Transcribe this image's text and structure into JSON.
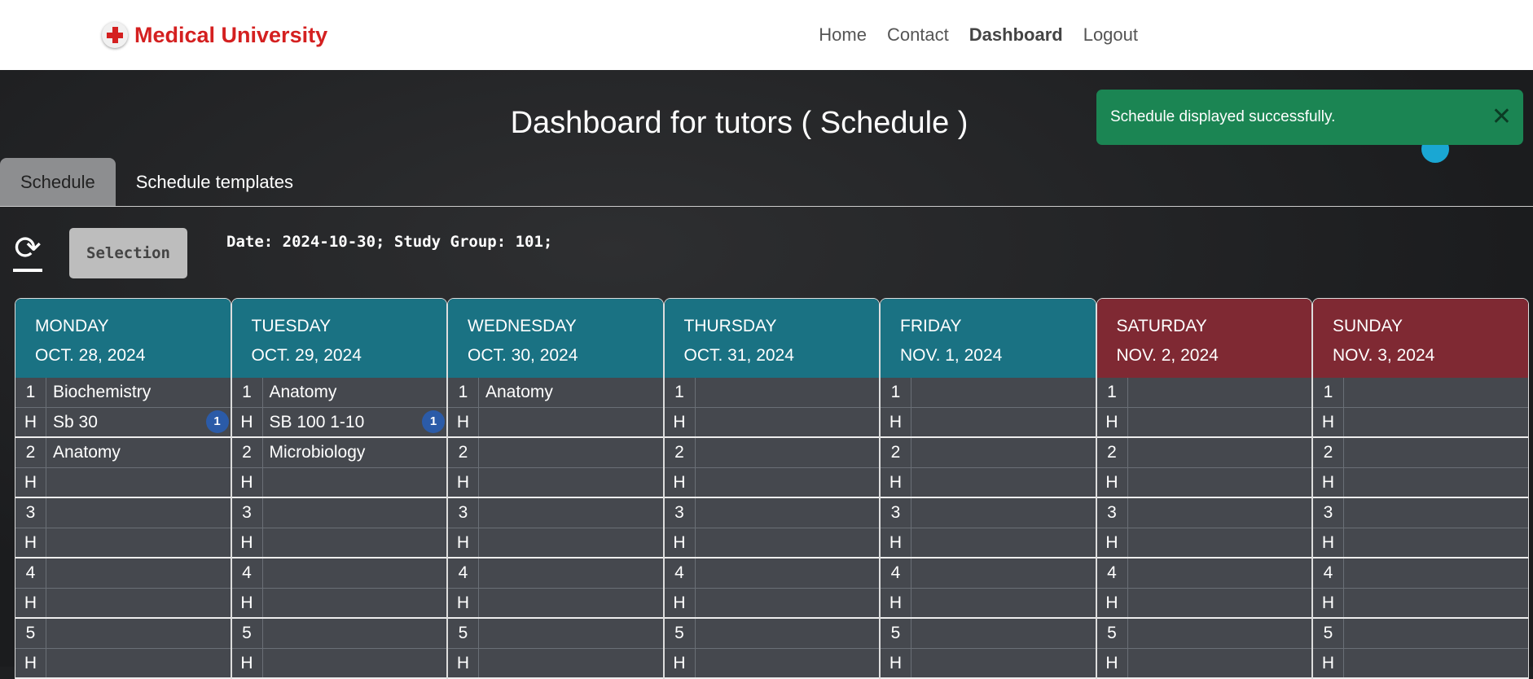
{
  "brand": {
    "name": "Medical University"
  },
  "nav": {
    "items": [
      "Home",
      "Contact",
      "Dashboard",
      "Logout"
    ],
    "active": "Dashboard"
  },
  "page": {
    "title": "Dashboard for tutors ( Schedule )"
  },
  "tabs": [
    {
      "label": "Schedule",
      "active": true
    },
    {
      "label": "Schedule templates",
      "active": false
    }
  ],
  "toolbar": {
    "refresh_icon": "refresh-icon",
    "selection_label": "Selection",
    "info": "Date: 2024-10-30; Study Group: 101;"
  },
  "toast": {
    "message": "Schedule displayed successfully.",
    "close_icon": "close-icon",
    "color": "#1b8553"
  },
  "colors": {
    "weekday_header": "#1a7283",
    "weekend_header": "#7f2933",
    "badge": "#2b5ba8"
  },
  "schedule": {
    "days": [
      {
        "name": "MONDAY",
        "date": "OCT. 28, 2024",
        "weekend": false,
        "rows": [
          [
            "1",
            "Biochemistry",
            ""
          ],
          [
            "H",
            "Sb 30",
            "1"
          ],
          [
            "2",
            "Anatomy",
            ""
          ],
          [
            "H",
            "",
            ""
          ],
          [
            "3",
            "",
            ""
          ],
          [
            "H",
            "",
            ""
          ],
          [
            "4",
            "",
            ""
          ],
          [
            "H",
            "",
            ""
          ],
          [
            "5",
            "",
            ""
          ],
          [
            "H",
            "",
            ""
          ]
        ]
      },
      {
        "name": "TUESDAY",
        "date": "OCT. 29, 2024",
        "weekend": false,
        "rows": [
          [
            "1",
            "Anatomy",
            ""
          ],
          [
            "H",
            "SB 100 1-10",
            "1"
          ],
          [
            "2",
            "Microbiology",
            ""
          ],
          [
            "H",
            "",
            ""
          ],
          [
            "3",
            "",
            ""
          ],
          [
            "H",
            "",
            ""
          ],
          [
            "4",
            "",
            ""
          ],
          [
            "H",
            "",
            ""
          ],
          [
            "5",
            "",
            ""
          ],
          [
            "H",
            "",
            ""
          ]
        ]
      },
      {
        "name": "WEDNESDAY",
        "date": "OCT. 30, 2024",
        "weekend": false,
        "rows": [
          [
            "1",
            "Anatomy",
            ""
          ],
          [
            "H",
            "",
            ""
          ],
          [
            "2",
            "",
            ""
          ],
          [
            "H",
            "",
            ""
          ],
          [
            "3",
            "",
            ""
          ],
          [
            "H",
            "",
            ""
          ],
          [
            "4",
            "",
            ""
          ],
          [
            "H",
            "",
            ""
          ],
          [
            "5",
            "",
            ""
          ],
          [
            "H",
            "",
            ""
          ]
        ]
      },
      {
        "name": "THURSDAY",
        "date": "OCT. 31, 2024",
        "weekend": false,
        "rows": [
          [
            "1",
            "",
            ""
          ],
          [
            "H",
            "",
            ""
          ],
          [
            "2",
            "",
            ""
          ],
          [
            "H",
            "",
            ""
          ],
          [
            "3",
            "",
            ""
          ],
          [
            "H",
            "",
            ""
          ],
          [
            "4",
            "",
            ""
          ],
          [
            "H",
            "",
            ""
          ],
          [
            "5",
            "",
            ""
          ],
          [
            "H",
            "",
            ""
          ]
        ]
      },
      {
        "name": "FRIDAY",
        "date": "NOV. 1, 2024",
        "weekend": false,
        "rows": [
          [
            "1",
            "",
            ""
          ],
          [
            "H",
            "",
            ""
          ],
          [
            "2",
            "",
            ""
          ],
          [
            "H",
            "",
            ""
          ],
          [
            "3",
            "",
            ""
          ],
          [
            "H",
            "",
            ""
          ],
          [
            "4",
            "",
            ""
          ],
          [
            "H",
            "",
            ""
          ],
          [
            "5",
            "",
            ""
          ],
          [
            "H",
            "",
            ""
          ]
        ]
      },
      {
        "name": "SATURDAY",
        "date": "NOV. 2, 2024",
        "weekend": true,
        "rows": [
          [
            "1",
            "",
            ""
          ],
          [
            "H",
            "",
            ""
          ],
          [
            "2",
            "",
            ""
          ],
          [
            "H",
            "",
            ""
          ],
          [
            "3",
            "",
            ""
          ],
          [
            "H",
            "",
            ""
          ],
          [
            "4",
            "",
            ""
          ],
          [
            "H",
            "",
            ""
          ],
          [
            "5",
            "",
            ""
          ],
          [
            "H",
            "",
            ""
          ]
        ]
      },
      {
        "name": "SUNDAY",
        "date": "NOV. 3, 2024",
        "weekend": true,
        "rows": [
          [
            "1",
            "",
            ""
          ],
          [
            "H",
            "",
            ""
          ],
          [
            "2",
            "",
            ""
          ],
          [
            "H",
            "",
            ""
          ],
          [
            "3",
            "",
            ""
          ],
          [
            "H",
            "",
            ""
          ],
          [
            "4",
            "",
            ""
          ],
          [
            "H",
            "",
            ""
          ],
          [
            "5",
            "",
            ""
          ],
          [
            "H",
            "",
            ""
          ]
        ]
      }
    ]
  }
}
